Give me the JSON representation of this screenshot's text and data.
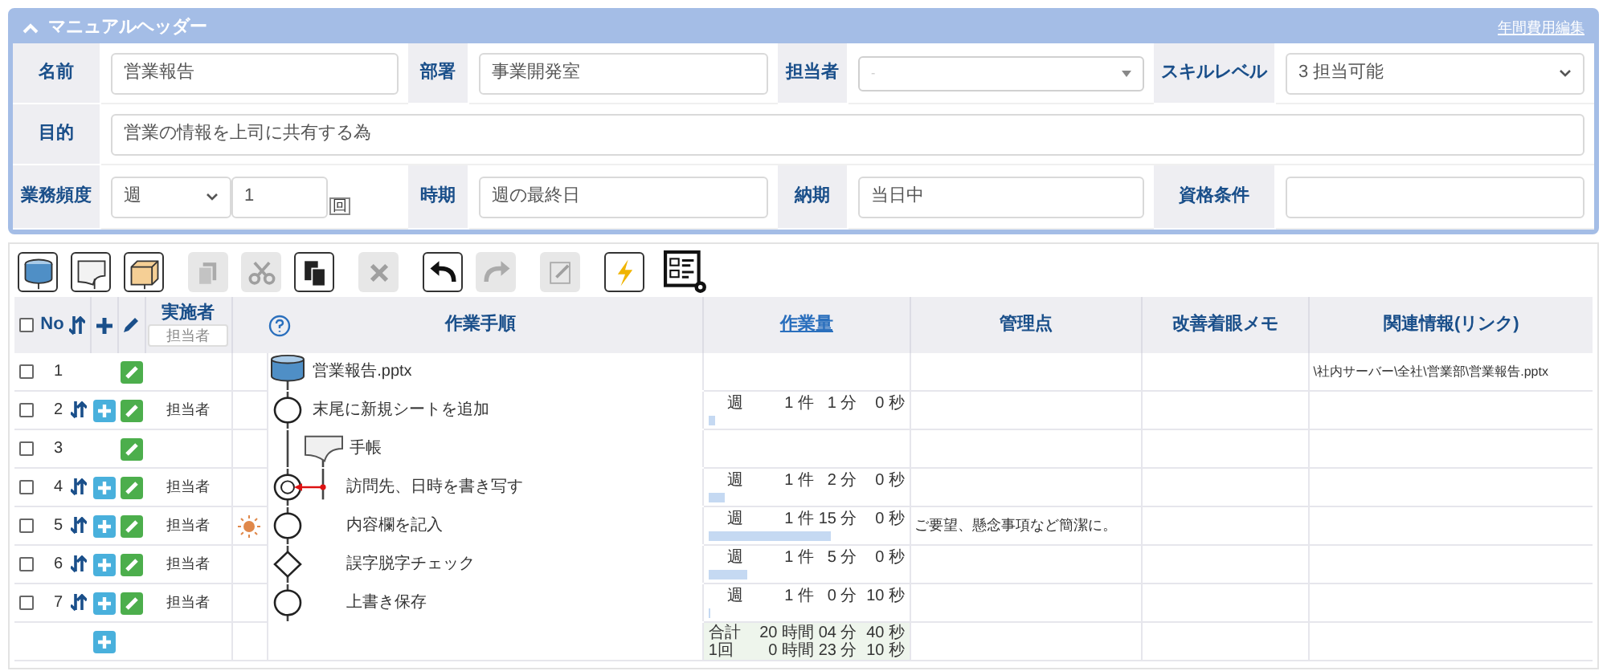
{
  "header": {
    "title": "マニュアルヘッダー",
    "expanded": true,
    "link": "年間費用編集",
    "fields": {
      "name": {
        "label": "名前",
        "value": "営業報告"
      },
      "department": {
        "label": "部署",
        "value": "事業開発室"
      },
      "assignee": {
        "label": "担当者",
        "placeholder": "-"
      },
      "skill": {
        "label": "スキルレベル",
        "value": "3 担当可能"
      },
      "purpose": {
        "label": "目的",
        "value": "営業の情報を上司に共有する為"
      },
      "frequency": {
        "label": "業務頻度",
        "value": "週",
        "count": "1",
        "unit": "回"
      },
      "timing": {
        "label": "時期",
        "value": "週の最終日"
      },
      "deadline": {
        "label": "納期",
        "value": "当日中"
      },
      "qualification": {
        "label": "資格条件"
      }
    }
  },
  "toolbar": [
    {
      "kind": "database",
      "disabled": false
    },
    {
      "kind": "document",
      "disabled": false
    },
    {
      "kind": "box",
      "disabled": false
    },
    {
      "kind": "copy",
      "disabled": true
    },
    {
      "kind": "cut",
      "disabled": true
    },
    {
      "kind": "paste",
      "disabled": false
    },
    {
      "kind": "delete",
      "disabled": true
    },
    {
      "kind": "undo",
      "disabled": false
    },
    {
      "kind": "redo",
      "disabled": true
    },
    {
      "kind": "note",
      "disabled": true
    },
    {
      "kind": "lightning",
      "disabled": false
    },
    {
      "kind": "checklist",
      "disabled": false
    }
  ],
  "table": {
    "select_all": false,
    "columns": {
      "no": "No",
      "performer": "実施者",
      "performer_field": "担当者",
      "procedure": "作業手順",
      "workload": "作業量",
      "control": "管理点",
      "memo": "改善着眼メモ",
      "link": "関連情報(リンク)"
    },
    "rows": [
      {
        "checked": false,
        "no": "1",
        "kind": "database",
        "step": "営業報告.pptx",
        "link": "\\社内サーバー\\全社\\営業部\\営業報告.pptx",
        "flagged": false
      },
      {
        "checked": false,
        "no": "2",
        "kind": "process",
        "assignee": "担当者",
        "step": "末尾に新規シートを追加",
        "flagged": false,
        "workload": {
          "period": "週",
          "count": "1 件",
          "minutes": "1 分",
          "seconds": "0 秒",
          "level": 0.03
        }
      },
      {
        "checked": false,
        "no": "3",
        "kind": "document",
        "step": "手帳",
        "flagged": false
      },
      {
        "checked": false,
        "no": "4",
        "kind": "input",
        "assignee": "担当者",
        "step": "訪問先、日時を書き写す",
        "flagged": false,
        "workload": {
          "period": "週",
          "count": "1 件",
          "minutes": "2 分",
          "seconds": "0 秒",
          "level": 0.08
        }
      },
      {
        "checked": false,
        "no": "5",
        "kind": "process",
        "assignee": "担当者",
        "step": "内容欄を記入",
        "flagged": true,
        "workload": {
          "period": "週",
          "count": "1 件",
          "minutes": "15 分",
          "seconds": "0 秒",
          "level": 0.62
        },
        "control": "ご要望、懸念事項など簡潔に。"
      },
      {
        "checked": false,
        "no": "6",
        "kind": "decision",
        "assignee": "担当者",
        "step": "誤字脱字チェック",
        "flagged": false,
        "workload": {
          "period": "週",
          "count": "1 件",
          "minutes": "5 分",
          "seconds": "0 秒",
          "level": 0.2
        }
      },
      {
        "checked": false,
        "no": "7",
        "kind": "process",
        "assignee": "担当者",
        "step": "上書き保存",
        "flagged": false,
        "workload": {
          "period": "週",
          "count": "1 件",
          "minutes": "0 分",
          "seconds": "10 秒",
          "level": 0.01
        }
      }
    ],
    "totals": [
      {
        "label": "合計",
        "hours": "20 時間",
        "minutes": "04 分",
        "seconds": "40 秒"
      },
      {
        "label": "1回",
        "hours": "0 時間",
        "minutes": "23 分",
        "seconds": "10 秒"
      }
    ]
  }
}
